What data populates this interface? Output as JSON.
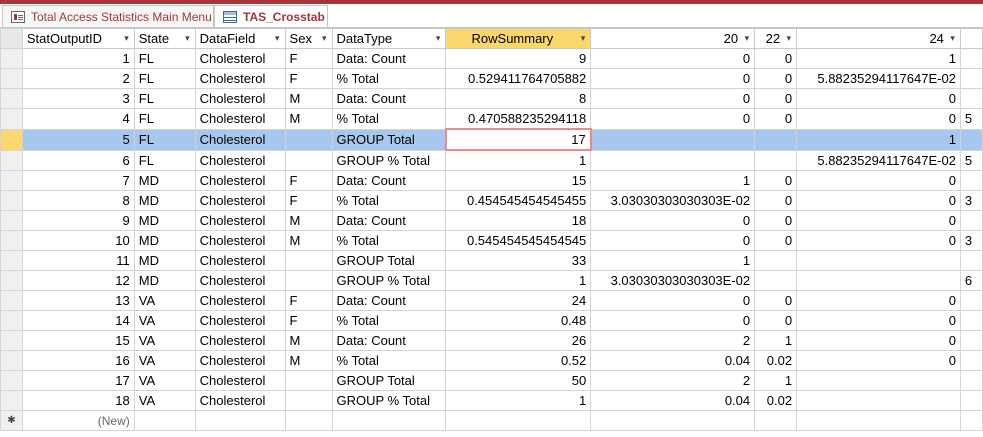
{
  "tabs": [
    {
      "label": "Total Access Statistics Main Menu",
      "icon": "form-icon",
      "active": false
    },
    {
      "label": "TAS_Crosstab",
      "icon": "table-icon",
      "active": true
    }
  ],
  "colors": {
    "accent": "#a4373a",
    "selected_row": "#a6c8ee",
    "selected_column_header": "#fbd76b",
    "active_cell_border": "#ea8a8a"
  },
  "grid": {
    "columns": [
      "StatOutputID",
      "State",
      "DataField",
      "Sex",
      "DataType",
      "RowSummary",
      "20",
      "22",
      "24",
      ""
    ],
    "sort_arrow": "▾",
    "rows": [
      [
        "1",
        "FL",
        "Cholesterol",
        "F",
        "Data: Count",
        "9",
        "0",
        "0",
        "1",
        ""
      ],
      [
        "2",
        "FL",
        "Cholesterol",
        "F",
        "% Total",
        "0.529411764705882",
        "0",
        "0",
        "5.88235294117647E-02",
        ""
      ],
      [
        "3",
        "FL",
        "Cholesterol",
        "M",
        "Data: Count",
        "8",
        "0",
        "0",
        "0",
        ""
      ],
      [
        "4",
        "FL",
        "Cholesterol",
        "M",
        "% Total",
        "0.470588235294118",
        "0",
        "0",
        "0",
        "5"
      ],
      [
        "5",
        "FL",
        "Cholesterol",
        "",
        "GROUP Total",
        "17",
        "",
        "",
        "1",
        ""
      ],
      [
        "6",
        "FL",
        "Cholesterol",
        "",
        "GROUP % Total",
        "1",
        "",
        "",
        "5.88235294117647E-02",
        "5"
      ],
      [
        "7",
        "MD",
        "Cholesterol",
        "F",
        "Data: Count",
        "15",
        "1",
        "0",
        "0",
        ""
      ],
      [
        "8",
        "MD",
        "Cholesterol",
        "F",
        "% Total",
        "0.454545454545455",
        "3.03030303030303E-02",
        "0",
        "0",
        "3"
      ],
      [
        "9",
        "MD",
        "Cholesterol",
        "M",
        "Data: Count",
        "18",
        "0",
        "0",
        "0",
        ""
      ],
      [
        "10",
        "MD",
        "Cholesterol",
        "M",
        "% Total",
        "0.545454545454545",
        "0",
        "0",
        "0",
        "3"
      ],
      [
        "11",
        "MD",
        "Cholesterol",
        "",
        "GROUP Total",
        "33",
        "1",
        "",
        "",
        ""
      ],
      [
        "12",
        "MD",
        "Cholesterol",
        "",
        "GROUP % Total",
        "1",
        "3.03030303030303E-02",
        "",
        "",
        "6"
      ],
      [
        "13",
        "VA",
        "Cholesterol",
        "F",
        "Data: Count",
        "24",
        "0",
        "0",
        "0",
        ""
      ],
      [
        "14",
        "VA",
        "Cholesterol",
        "F",
        "% Total",
        "0.48",
        "0",
        "0",
        "0",
        ""
      ],
      [
        "15",
        "VA",
        "Cholesterol",
        "M",
        "Data: Count",
        "26",
        "2",
        "1",
        "0",
        ""
      ],
      [
        "16",
        "VA",
        "Cholesterol",
        "M",
        "% Total",
        "0.52",
        "0.04",
        "0.02",
        "0",
        ""
      ],
      [
        "17",
        "VA",
        "Cholesterol",
        "",
        "GROUP Total",
        "50",
        "2",
        "1",
        "",
        ""
      ],
      [
        "18",
        "VA",
        "Cholesterol",
        "",
        "GROUP % Total",
        "1",
        "0.04",
        "0.02",
        "",
        ""
      ]
    ],
    "selected_row_index": 4,
    "active_cell_column": 5,
    "selected_column": 5,
    "new_row_marker": "✱",
    "new_row_text": "(New)"
  }
}
